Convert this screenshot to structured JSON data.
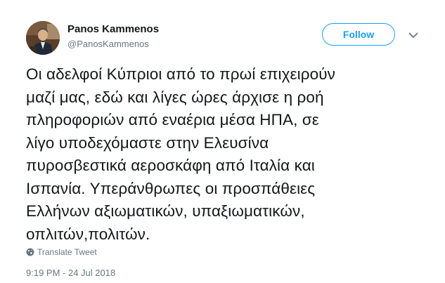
{
  "author": {
    "display_name": "Panos Kammenos",
    "handle": "@PanosKammenos"
  },
  "follow_label": "Follow",
  "accent_color": "#1da1f2",
  "icons": {
    "menu": "chevron-down-icon",
    "translate": "globe-icon"
  },
  "tweet": {
    "lines": [
      "Οι αδελφοί Κύπριοι από το πρωί επιχειρούν",
      "μαζί μας, εδώ και λίγες ώρες άρχισε η ροή",
      "πληροφοριών από εναέρια μέσα ΗΠΑ, σε",
      "λίγο υποδεχόμαστε στην Ελευσίνα",
      "πυροσβεστικά αεροσκάφη από Ιταλία και",
      "Ισπανία. Υπεράνθρωπες οι προσπάθειες",
      "Ελλήνων αξιωματικών, υπαξιωματικών,",
      "οπλιτών,πολιτών."
    ]
  },
  "translate_label": "Translate Tweet",
  "timestamp": "9:19 PM - 24 Jul 2018"
}
